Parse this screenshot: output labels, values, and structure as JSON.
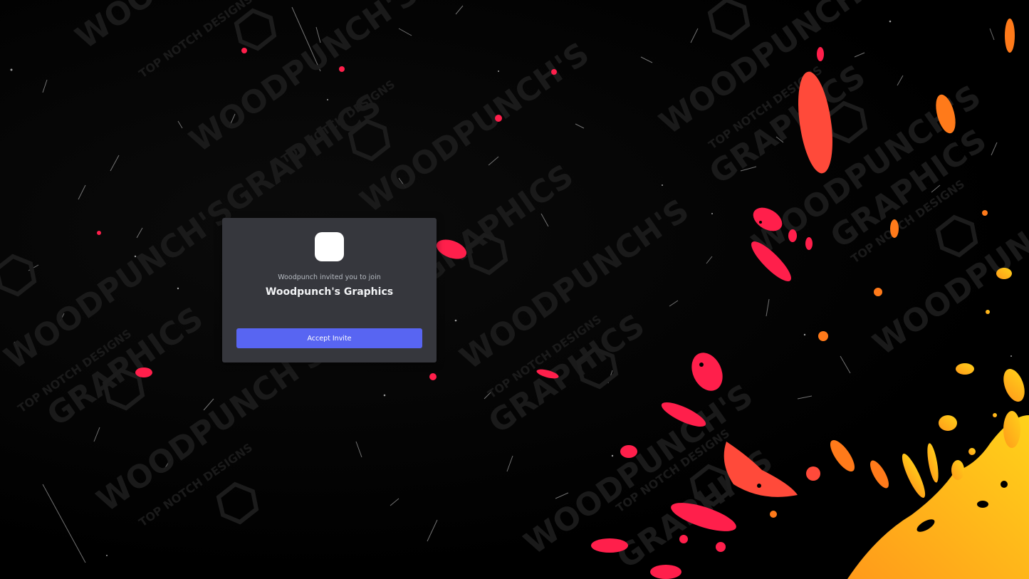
{
  "invite": {
    "inviter_text": "Woodpunch invited you to join",
    "server_name": "Woodpunch's Graphics",
    "accept_label": "Accept Invite"
  },
  "background": {
    "watermark_main": "WOODPUNCH'S",
    "watermark_sub": "GRAPHICS",
    "watermark_tag": "TOP NOTCH DESIGNS"
  },
  "colors": {
    "card": "#36373d",
    "accent": "#5865f2",
    "splash_red": "#ff1f4b",
    "splash_orange": "#ff7a1a",
    "splash_yellow": "#ffc21a"
  }
}
